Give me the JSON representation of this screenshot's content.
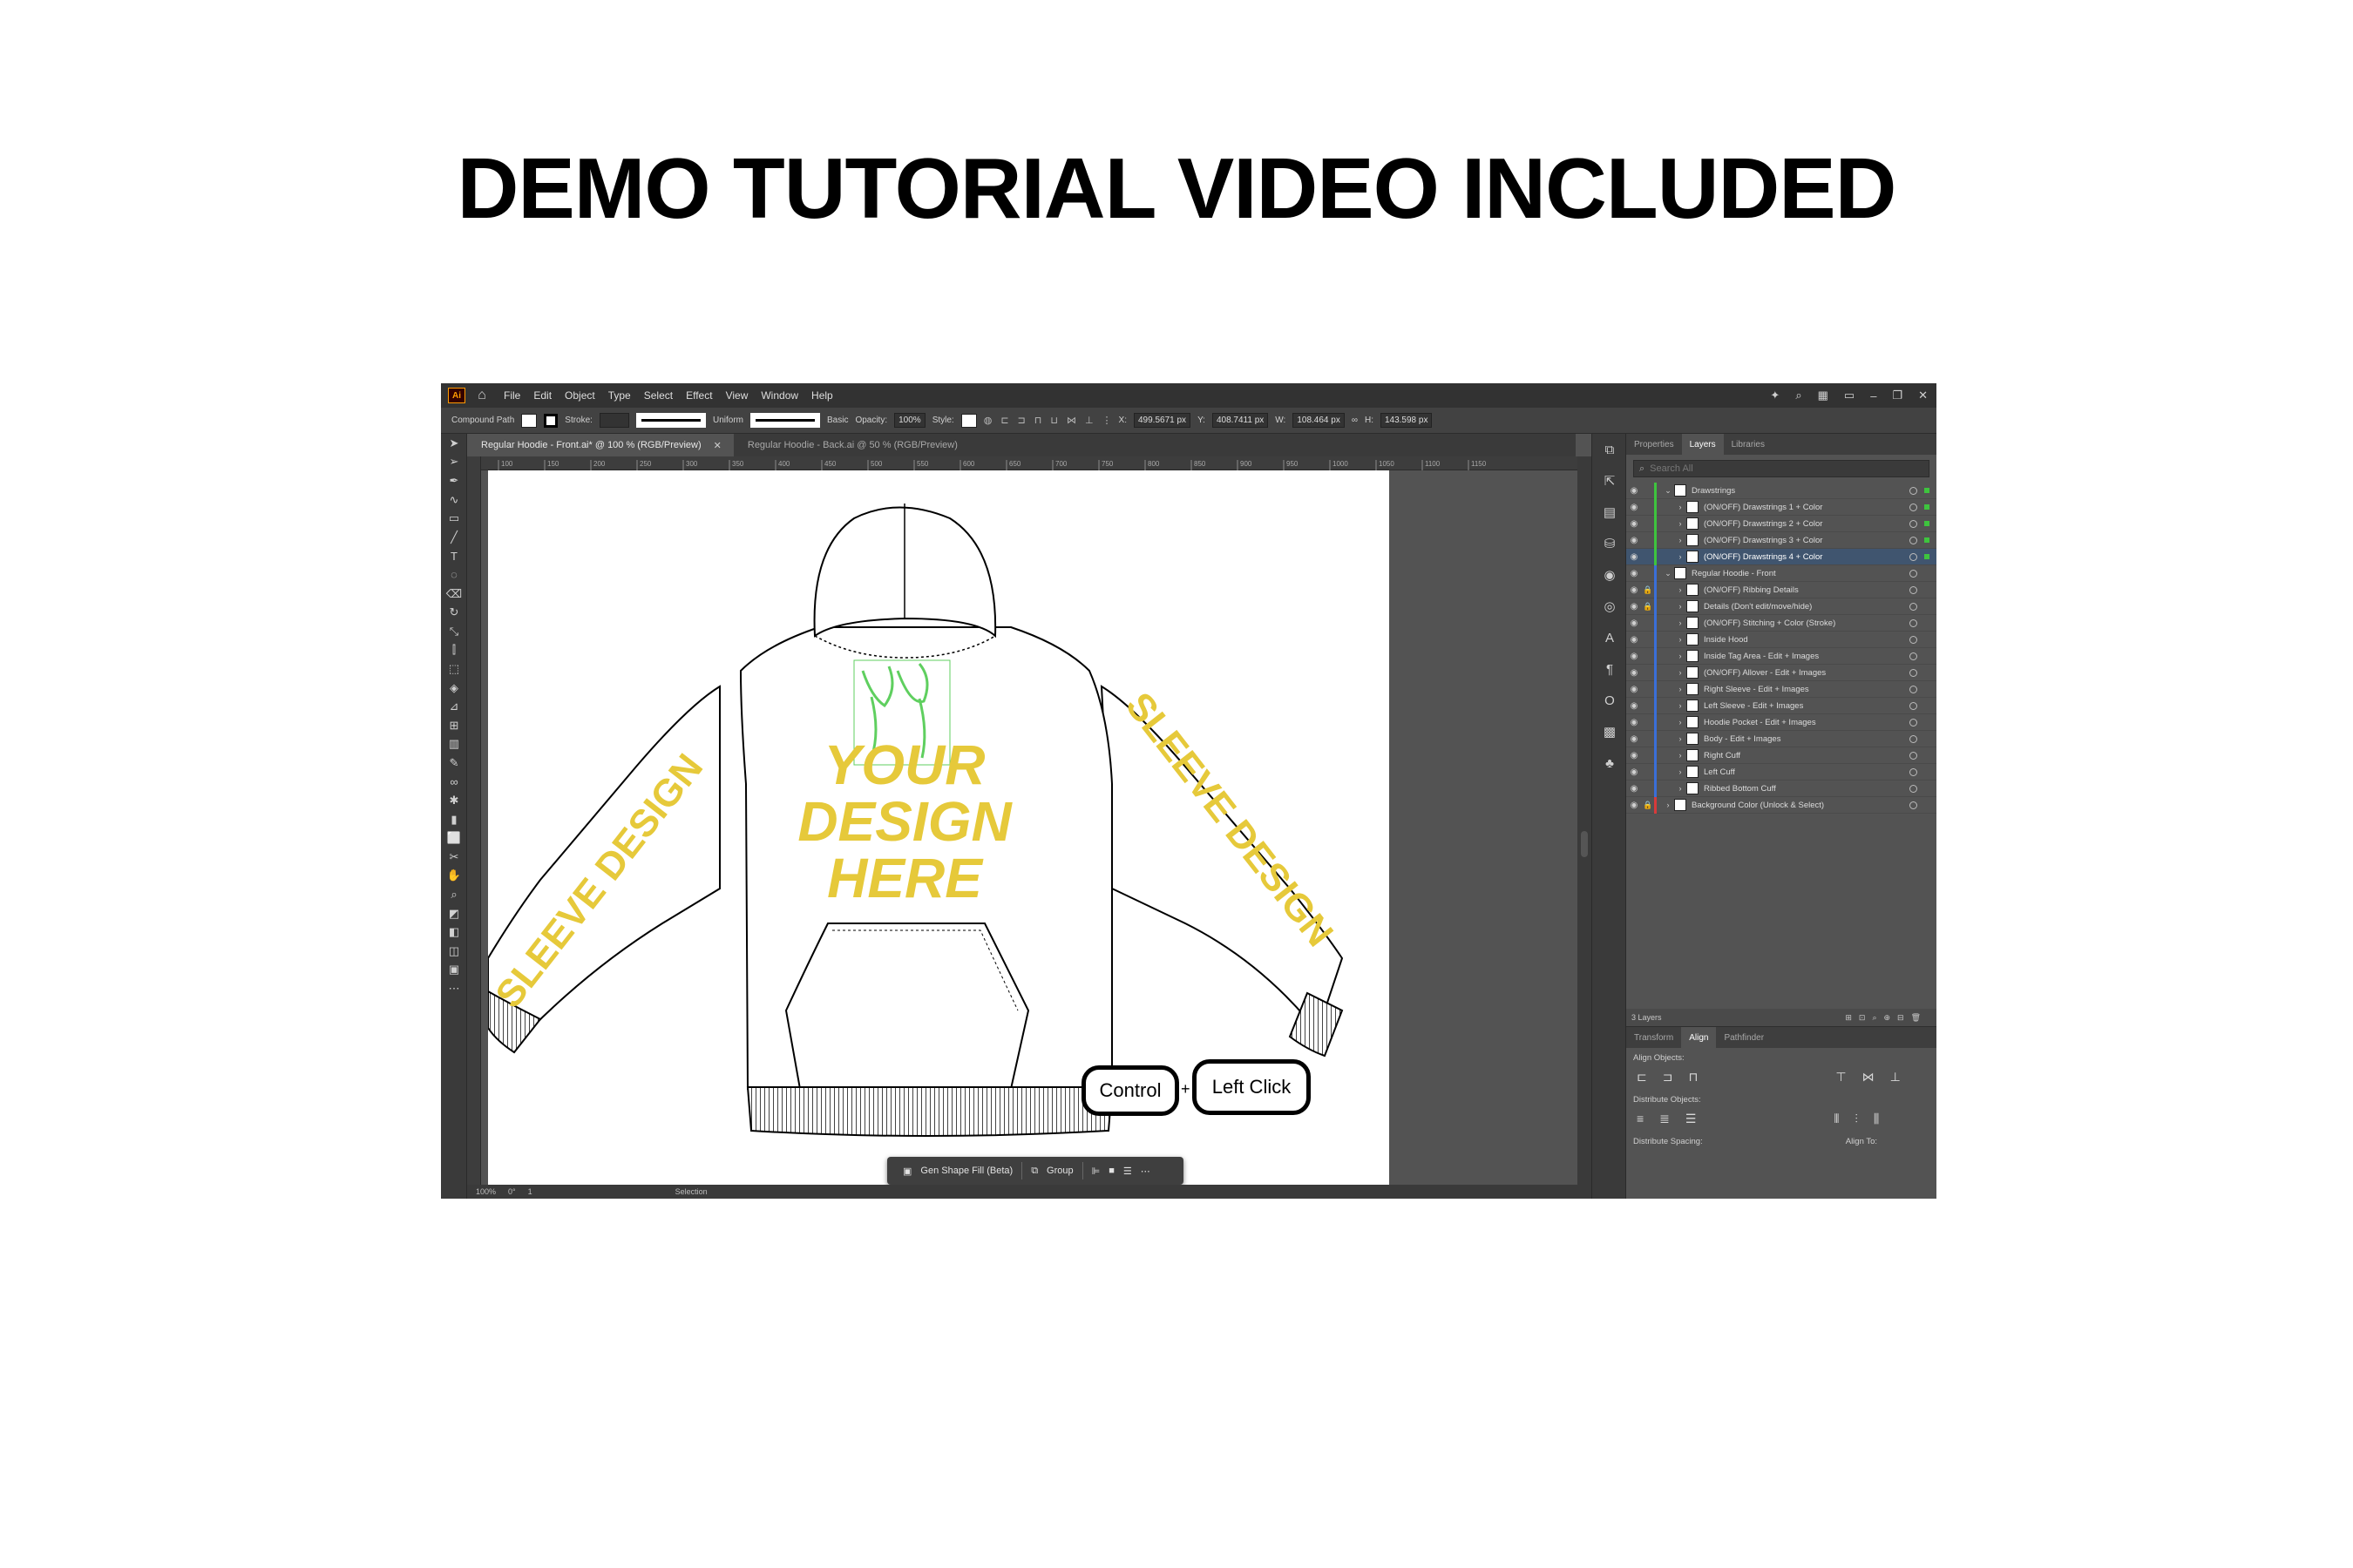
{
  "headline": "DEMO TUTORIAL VIDEO INCLUDED",
  "app": {
    "logo": "Ai",
    "menu": [
      "File",
      "Edit",
      "Object",
      "Type",
      "Select",
      "Effect",
      "View",
      "Window",
      "Help"
    ],
    "control": {
      "selection_type": "Compound Path",
      "stroke_label": "Stroke:",
      "uniform_label": "Uniform",
      "basic_label": "Basic",
      "opacity_label": "Opacity:",
      "opacity_value": "100%",
      "style_label": "Style:",
      "x_label": "X:",
      "x_value": "499.5671 px",
      "y_label": "Y:",
      "y_value": "408.7411 px",
      "w_label": "W:",
      "w_value": "108.464 px",
      "h_label": "H:",
      "h_value": "143.598 px"
    },
    "tabs": [
      {
        "label": "Regular Hoodie - Front.ai* @ 100 % (RGB/Preview)",
        "active": true
      },
      {
        "label": "Regular Hoodie - Back.ai @ 50 % (RGB/Preview)",
        "active": false
      }
    ],
    "ruler_ticks": [
      "100",
      "150",
      "200",
      "250",
      "300",
      "350",
      "400",
      "450",
      "500",
      "550",
      "600",
      "650",
      "700",
      "750",
      "800",
      "850",
      "900",
      "950",
      "1000",
      "1050",
      "1100",
      "1150"
    ],
    "artboard": {
      "front_text": [
        "YOUR",
        "DESIGN",
        "HERE"
      ],
      "sleeve_text": "SLEEVE DESIGN",
      "accent_color": "#e6c93a",
      "selection_color": "#5fcf5f"
    },
    "status": {
      "zoom": "100%",
      "rotation": "0°",
      "artboard_number": "1",
      "mode": "Selection"
    },
    "taskbar": {
      "gen_shape_fill": "Gen Shape Fill (Beta)",
      "group": "Group"
    },
    "keys": {
      "control": "Control",
      "plus": "+",
      "left_click": "Left Click"
    },
    "layers_panel": {
      "tabs": [
        "Properties",
        "Layers",
        "Libraries"
      ],
      "active_tab": "Layers",
      "search_placeholder": "Search All",
      "rows": [
        {
          "label": "Drawstrings",
          "indent": 0,
          "expanded": true,
          "color": "#3ec43e",
          "lock": false,
          "selected": false
        },
        {
          "label": "(ON/OFF) Drawstrings 1 + Color",
          "indent": 1,
          "expanded": false,
          "color": "#3ec43e",
          "lock": false,
          "selected": false
        },
        {
          "label": "(ON/OFF) Drawstrings 2 + Color",
          "indent": 1,
          "expanded": false,
          "color": "#3ec43e",
          "lock": false,
          "selected": false
        },
        {
          "label": "(ON/OFF) Drawstrings 3 + Color",
          "indent": 1,
          "expanded": false,
          "color": "#3ec43e",
          "lock": false,
          "selected": false
        },
        {
          "label": "(ON/OFF) Drawstrings 4 + Color",
          "indent": 1,
          "expanded": false,
          "color": "#3ec43e",
          "lock": false,
          "selected": true
        },
        {
          "label": "Regular Hoodie - Front",
          "indent": 0,
          "expanded": true,
          "color": "#3a6fd8",
          "lock": false,
          "selected": false
        },
        {
          "label": "(ON/OFF) Ribbing Details",
          "indent": 1,
          "expanded": false,
          "color": "#3a6fd8",
          "lock": true,
          "selected": false
        },
        {
          "label": "Details (Don't edit/move/hide)",
          "indent": 1,
          "expanded": false,
          "color": "#3a6fd8",
          "lock": true,
          "selected": false
        },
        {
          "label": "(ON/OFF) Stitching + Color (Stroke)",
          "indent": 1,
          "expanded": false,
          "color": "#3a6fd8",
          "lock": false,
          "selected": false
        },
        {
          "label": "Inside Hood",
          "indent": 1,
          "expanded": false,
          "color": "#3a6fd8",
          "lock": false,
          "selected": false
        },
        {
          "label": "Inside Tag Area - Edit + Images",
          "indent": 1,
          "expanded": false,
          "color": "#3a6fd8",
          "lock": false,
          "selected": false
        },
        {
          "label": "(ON/OFF) Allover - Edit + Images",
          "indent": 1,
          "expanded": false,
          "color": "#3a6fd8",
          "lock": false,
          "selected": false
        },
        {
          "label": "Right Sleeve - Edit + Images",
          "indent": 1,
          "expanded": false,
          "color": "#3a6fd8",
          "lock": false,
          "selected": false
        },
        {
          "label": "Left Sleeve - Edit + Images",
          "indent": 1,
          "expanded": false,
          "color": "#3a6fd8",
          "lock": false,
          "selected": false
        },
        {
          "label": "Hoodie Pocket - Edit + Images",
          "indent": 1,
          "expanded": false,
          "color": "#3a6fd8",
          "lock": false,
          "selected": false
        },
        {
          "label": "Body - Edit + Images",
          "indent": 1,
          "expanded": false,
          "color": "#3a6fd8",
          "lock": false,
          "selected": false
        },
        {
          "label": "Right Cuff",
          "indent": 1,
          "expanded": false,
          "color": "#3a6fd8",
          "lock": false,
          "selected": false
        },
        {
          "label": "Left Cuff",
          "indent": 1,
          "expanded": false,
          "color": "#3a6fd8",
          "lock": false,
          "selected": false
        },
        {
          "label": "Ribbed Bottom Cuff",
          "indent": 1,
          "expanded": false,
          "color": "#3a6fd8",
          "lock": false,
          "selected": false
        },
        {
          "label": "Background Color (Unlock & Select)",
          "indent": 0,
          "expanded": false,
          "color": "#d83a3a",
          "lock": true,
          "selected": false
        }
      ],
      "footer": "3 Layers"
    },
    "align_panel": {
      "tabs": [
        "Transform",
        "Align",
        "Pathfinder"
      ],
      "active_tab": "Align",
      "align_objects": "Align Objects:",
      "distribute_objects": "Distribute Objects:",
      "distribute_spacing": "Distribute Spacing:",
      "align_to": "Align To:"
    }
  }
}
